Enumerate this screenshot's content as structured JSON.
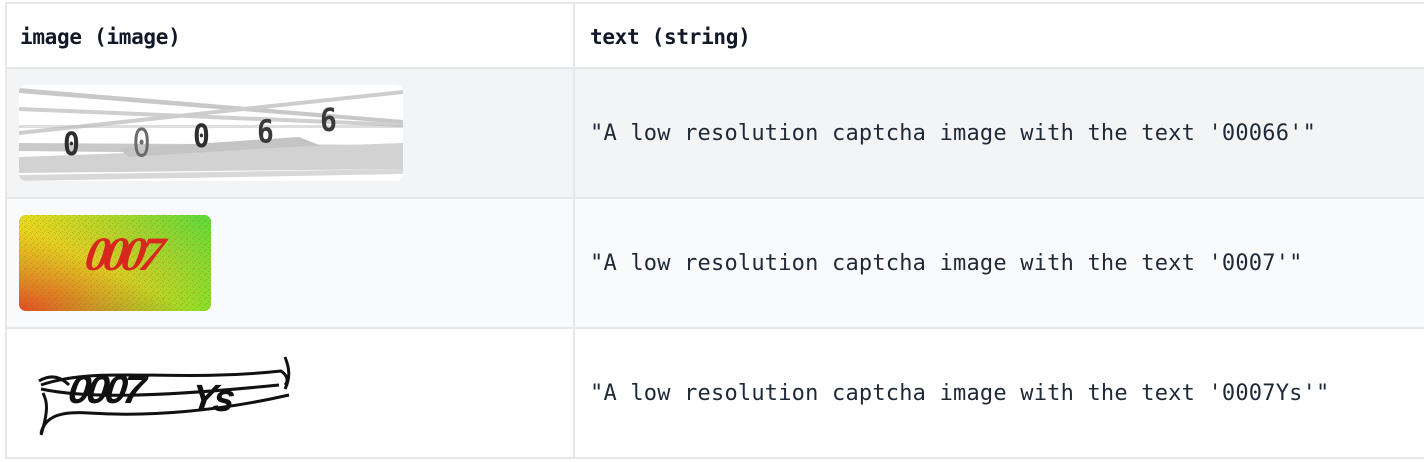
{
  "columns": [
    {
      "name": "image",
      "type": "(image)"
    },
    {
      "name": "text",
      "type": "(string)"
    }
  ],
  "rows": [
    {
      "image": {
        "captcha_text": "00066",
        "style": "pixelated gray digits with crossing gray lines"
      },
      "text": "\"A low resolution captcha image with the text '00066'\""
    },
    {
      "image": {
        "captcha_text": "0007",
        "style": "red italic digits on red-yellow-green noisy gradient"
      },
      "text": "\"A low resolution captcha image with the text '0007'\""
    },
    {
      "image": {
        "captcha_text": "0007Ys",
        "style": "black warped text with curved strike lines"
      },
      "text": "\"A low resolution captcha image with the text '0007Ys'\""
    }
  ],
  "colors": {
    "border": "#e5e7eb",
    "row_even": "#f3f4f6",
    "row_odd": "#f9fafb",
    "header_text": "#111827",
    "cell_text": "#1f2937"
  }
}
